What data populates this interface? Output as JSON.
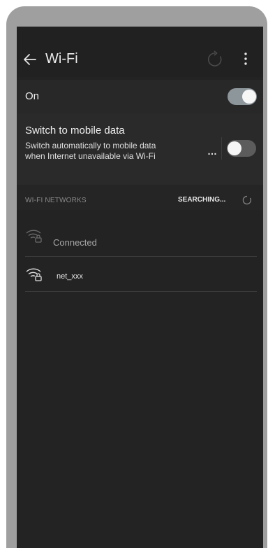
{
  "header": {
    "title": "Wi-Fi"
  },
  "wifi_switch": {
    "label": "On",
    "enabled": true
  },
  "mobile_data": {
    "title": "Switch to mobile data",
    "description": "Switch automatically to mobile data when Internet unavailable via Wi-Fi",
    "more_label": "…",
    "enabled": false
  },
  "networks_section": {
    "label": "WI-FI NETWORKS",
    "status": "SEARCHING..."
  },
  "networks": [
    {
      "name": "",
      "status": "Connected",
      "icon": "wifi-lock-icon"
    },
    {
      "name": "net_xxx",
      "status": "",
      "icon": "wifi-lock-icon"
    }
  ],
  "colors": {
    "background": "#232323",
    "toggle_on_track": "#8d969b",
    "toggle_off_track": "#5c5c5c",
    "text_primary": "#f0f0f0"
  }
}
